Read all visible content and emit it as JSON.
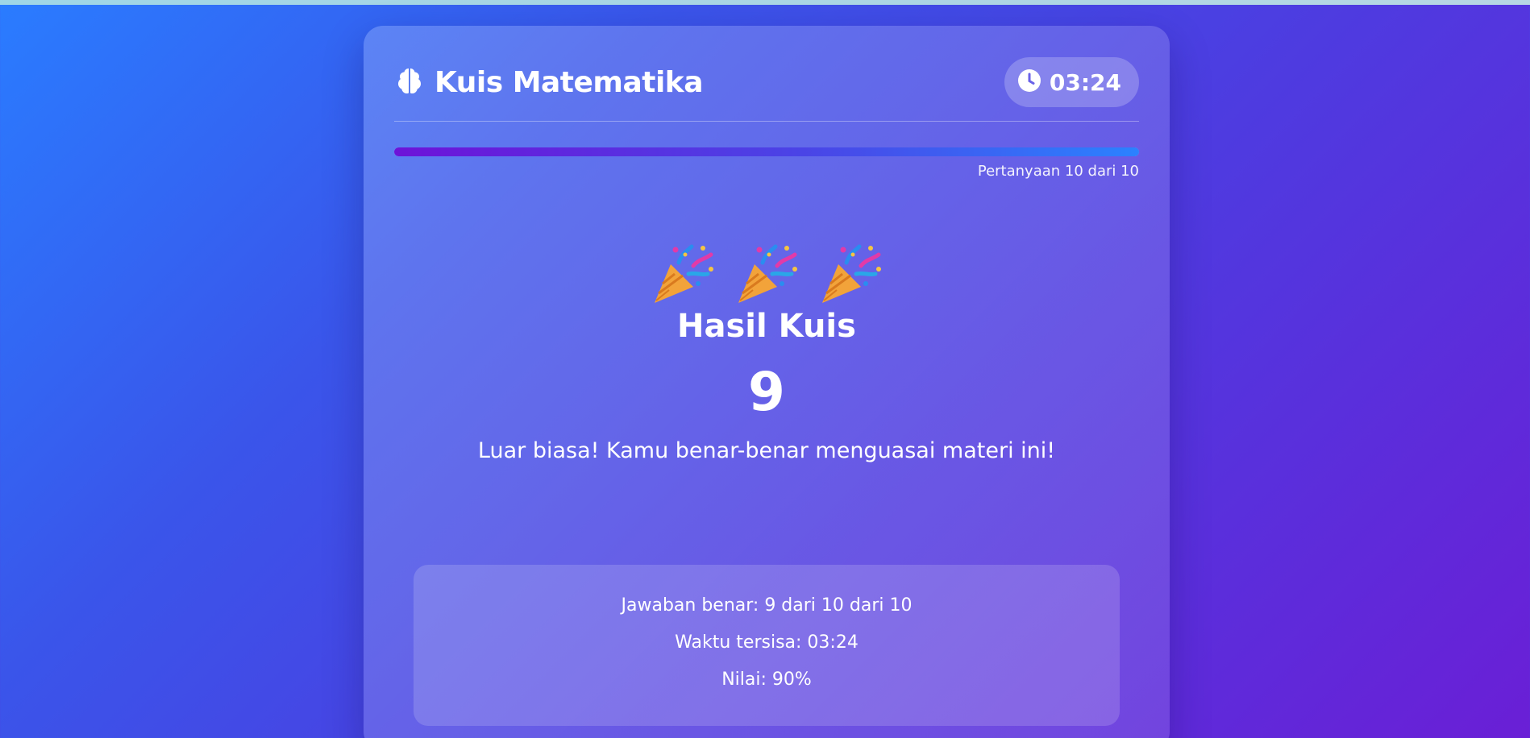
{
  "app": {
    "title": "Kuis Matematika",
    "brand_icon": "brain-icon",
    "timer_icon": "clock-icon",
    "timer": "03:24"
  },
  "progress": {
    "label": "Pertanyaan 10 dari 10",
    "fraction": 1.0
  },
  "celebration": {
    "icons": [
      "party-popper-icon",
      "party-popper-icon",
      "party-popper-icon"
    ]
  },
  "result": {
    "title": "Hasil Kuis",
    "score": "9",
    "message": "Luar biasa! Kamu benar-benar menguasai materi ini!"
  },
  "stats": {
    "correct": "Jawaban benar: 9 dari 10 dari 10",
    "time_left": "Waktu tersisa: 03:24",
    "grade": "Nilai: 90%"
  },
  "colors": {
    "background_start": "#2a7cff",
    "background_end": "#6a1fd6",
    "progress_start": "#6d13d8",
    "progress_end": "#2b82ff"
  }
}
